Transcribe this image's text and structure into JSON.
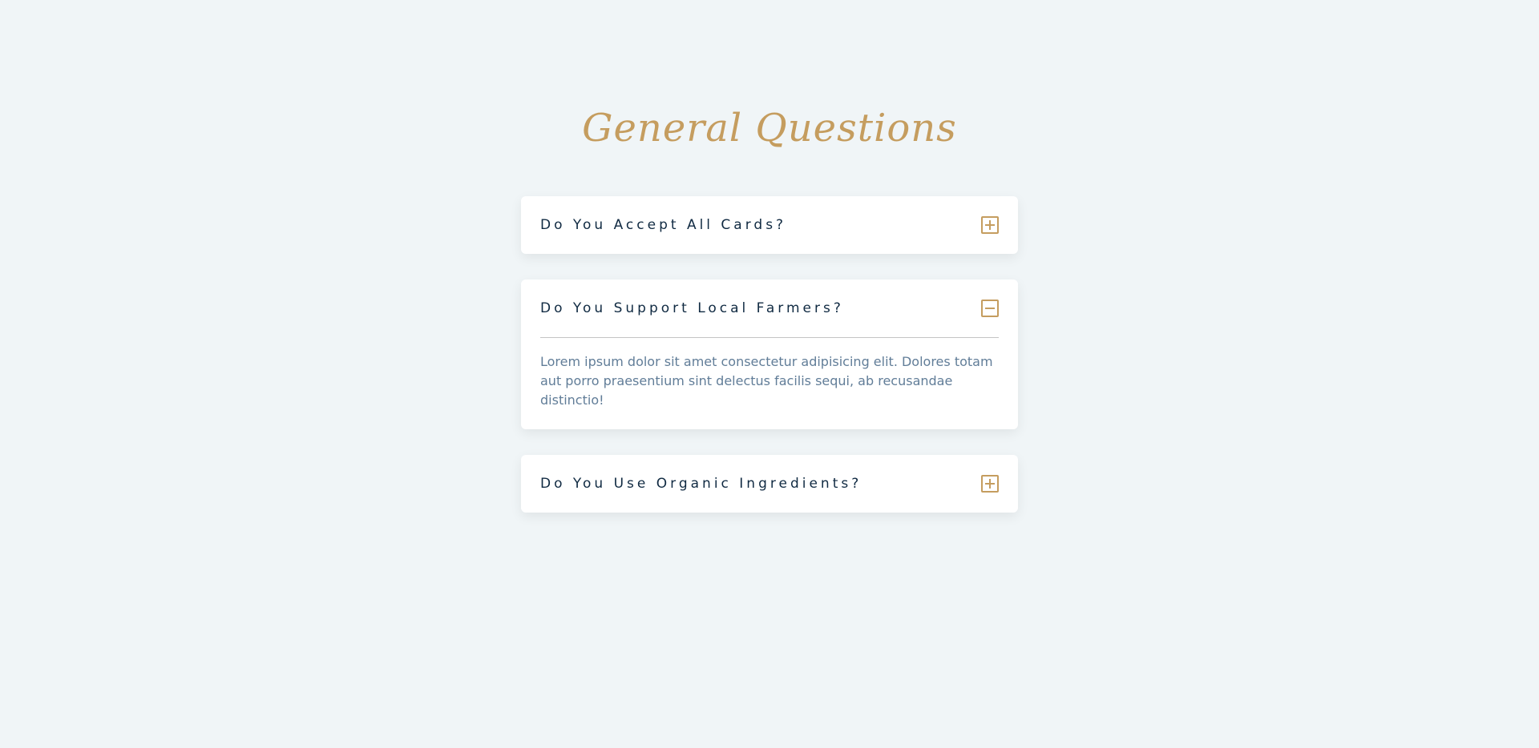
{
  "page": {
    "title": "General Questions"
  },
  "colors": {
    "background": "#f0f5f7",
    "accent": "#c59d5f",
    "question_text": "#102a42",
    "answer_text": "#617d98"
  },
  "faqs": [
    {
      "question": "Do You Accept All Cards?",
      "expanded": false,
      "toggle_icon": "plus-square-icon"
    },
    {
      "question": "Do You Support Local Farmers?",
      "expanded": true,
      "toggle_icon": "minus-square-icon",
      "answer": "Lorem ipsum dolor sit amet consectetur adipisicing elit. Dolores totam aut porro praesentium sint delectus facilis sequi, ab recusandae distinctio!"
    },
    {
      "question": "Do You Use Organic Ingredients?",
      "expanded": false,
      "toggle_icon": "plus-square-icon"
    }
  ]
}
